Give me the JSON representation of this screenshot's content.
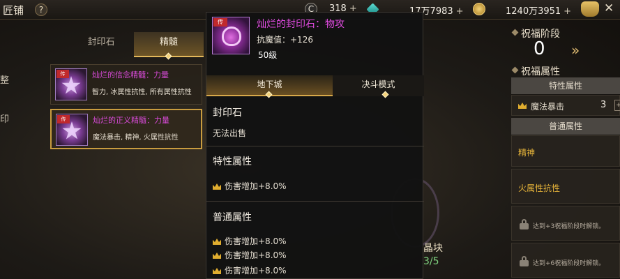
{
  "topbar": {
    "title": "匠铺",
    "help_glyph": "?",
    "currency1": "318",
    "currency2": "17万7983",
    "currency3": "1240万3951",
    "plus": "+",
    "close_glyph": "✕",
    "colors": {
      "gem": "#22b8b0",
      "gold": "#e3b346",
      "bag": "#d9ad4d"
    }
  },
  "left": {
    "tab_seal": "封印石",
    "tab_essence": "精髓",
    "side_label_1": "整",
    "side_label_2": "印",
    "items": [
      {
        "name": "灿烂的信念精髓：力量",
        "desc": "智力, 冰属性抗性, 所有属性抗性",
        "tag": "传"
      },
      {
        "name": "灿烂的正义精髓：力量",
        "desc": "魔法暴击, 精神, 火属性抗性",
        "tag": "传"
      }
    ]
  },
  "popup": {
    "icon_tag": "传",
    "name": "灿烂的封印石：物攻",
    "stat": "抗魔值：+126",
    "level": "50级",
    "tab_active": "地下城",
    "tab_inactive": "决斗模式",
    "sec1_title": "封印石",
    "sec1_text": "无法出售",
    "sec2_title": "特性属性",
    "sec2_rows": [
      "伤害增加+8.0%"
    ],
    "sec3_title": "普通属性",
    "sec3_rows": [
      "伤害增加+8.0%",
      "伤害增加+8.0%",
      "伤害增加+8.0%"
    ]
  },
  "middle": {
    "frag_label": "晶块",
    "frag_count": "3/5"
  },
  "right": {
    "stage_heading": "祝福阶段",
    "stage_value": "0",
    "arrow_glyph": "»",
    "attr_heading": "祝福属性",
    "special_bar": "特性属性",
    "special_row": {
      "label": "魔法暴击",
      "value": "3",
      "ctrl": "+"
    },
    "normal_bar": "普通属性",
    "normal_rows": [
      "精神",
      "火属性抗性"
    ],
    "locked_rows": [
      "达到+3祝福阶段时解锁。",
      "达到+6祝福阶段时解锁。"
    ]
  }
}
